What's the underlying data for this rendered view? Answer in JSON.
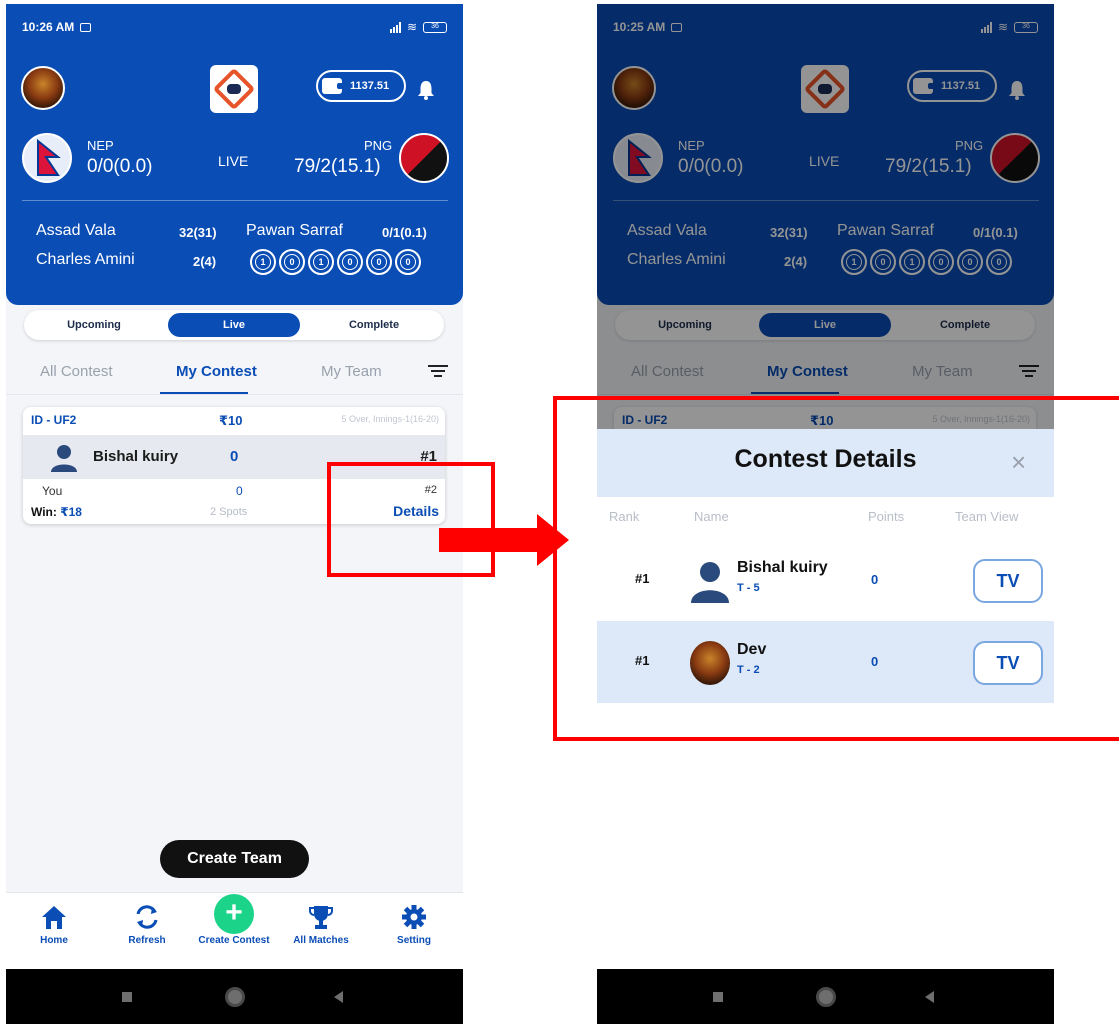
{
  "left": {
    "status": {
      "time": "10:26 AM",
      "battery": "36"
    },
    "wallet": "1137.51",
    "match": {
      "team1": {
        "code": "NEP",
        "score": "0/0(0.0)"
      },
      "status": "LIVE",
      "team2": {
        "code": "PNG",
        "score": "79/2(15.1)"
      }
    },
    "batsmen": [
      {
        "name": "Assad Vala",
        "stat": "32(31)"
      },
      {
        "name": "Charles Amini",
        "stat": "2(4)"
      }
    ],
    "bowler": {
      "name": "Pawan Sarraf",
      "stat": "0/1(0.1)"
    },
    "balls": [
      "1",
      "0",
      "1",
      "0",
      "0",
      "0"
    ],
    "segments": [
      "Upcoming",
      "Live",
      "Complete"
    ],
    "tabs": [
      "All Contest",
      "My Contest",
      "My Team"
    ],
    "contest": {
      "id": "ID - UF2",
      "fee": "₹10",
      "info": "5 Over, Innings-1(16-20)",
      "user_name": "Bishal kuiry",
      "user_points": "0",
      "user_rank": "#1",
      "you_label": "You",
      "you_points": "0",
      "you_rank": "#2",
      "win_label": "Win:",
      "win_amount": "₹18",
      "spots": "2 Spots",
      "details": "Details"
    },
    "create_team": "Create Team",
    "nav": [
      "Home",
      "Refresh",
      "Create Contest",
      "All Matches",
      "Setting"
    ]
  },
  "right": {
    "status": {
      "time": "10:25 AM",
      "battery": "36"
    },
    "wallet": "1137.51",
    "match": {
      "team1": {
        "code": "NEP",
        "score": "0/0(0.0)"
      },
      "status": "LIVE",
      "team2": {
        "code": "PNG",
        "score": "79/2(15.1)"
      }
    },
    "batsmen": [
      {
        "name": "Assad Vala",
        "stat": "32(31)"
      },
      {
        "name": "Charles Amini",
        "stat": "2(4)"
      }
    ],
    "bowler": {
      "name": "Pawan Sarraf",
      "stat": "0/1(0.1)"
    },
    "balls": [
      "1",
      "0",
      "1",
      "0",
      "0",
      "0"
    ],
    "segments": [
      "Upcoming",
      "Live",
      "Complete"
    ],
    "tabs": [
      "All Contest",
      "My Contest",
      "My Team"
    ],
    "contest_peek": {
      "id": "ID - UF2",
      "fee": "₹10",
      "info": "5 Over, Innings-1(16-20)"
    },
    "modal": {
      "title": "Contest Details",
      "close": "×",
      "headers": [
        "Rank",
        "Name",
        "Points",
        "Team View"
      ],
      "rows": [
        {
          "rank": "#1",
          "name": "Bishal kuiry",
          "team": "T - 5",
          "points": "0",
          "tv": "TV"
        },
        {
          "rank": "#1",
          "name": "Dev",
          "team": "T - 2",
          "points": "0",
          "tv": "TV"
        }
      ]
    }
  },
  "colors": {
    "primary": "#0a4db5",
    "accent_green": "#1cd38a",
    "annotation_red": "#ff0000"
  }
}
